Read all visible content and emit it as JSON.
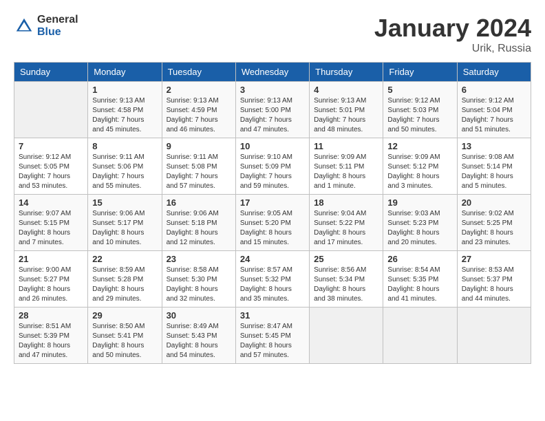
{
  "logo": {
    "general": "General",
    "blue": "Blue"
  },
  "title": {
    "month": "January 2024",
    "location": "Urik, Russia"
  },
  "weekdays": [
    "Sunday",
    "Monday",
    "Tuesday",
    "Wednesday",
    "Thursday",
    "Friday",
    "Saturday"
  ],
  "weeks": [
    [
      {
        "day": "",
        "sunrise": "",
        "sunset": "",
        "daylight": ""
      },
      {
        "day": "1",
        "sunrise": "Sunrise: 9:13 AM",
        "sunset": "Sunset: 4:58 PM",
        "daylight": "Daylight: 7 hours and 45 minutes."
      },
      {
        "day": "2",
        "sunrise": "Sunrise: 9:13 AM",
        "sunset": "Sunset: 4:59 PM",
        "daylight": "Daylight: 7 hours and 46 minutes."
      },
      {
        "day": "3",
        "sunrise": "Sunrise: 9:13 AM",
        "sunset": "Sunset: 5:00 PM",
        "daylight": "Daylight: 7 hours and 47 minutes."
      },
      {
        "day": "4",
        "sunrise": "Sunrise: 9:13 AM",
        "sunset": "Sunset: 5:01 PM",
        "daylight": "Daylight: 7 hours and 48 minutes."
      },
      {
        "day": "5",
        "sunrise": "Sunrise: 9:12 AM",
        "sunset": "Sunset: 5:03 PM",
        "daylight": "Daylight: 7 hours and 50 minutes."
      },
      {
        "day": "6",
        "sunrise": "Sunrise: 9:12 AM",
        "sunset": "Sunset: 5:04 PM",
        "daylight": "Daylight: 7 hours and 51 minutes."
      }
    ],
    [
      {
        "day": "7",
        "sunrise": "Sunrise: 9:12 AM",
        "sunset": "Sunset: 5:05 PM",
        "daylight": "Daylight: 7 hours and 53 minutes."
      },
      {
        "day": "8",
        "sunrise": "Sunrise: 9:11 AM",
        "sunset": "Sunset: 5:06 PM",
        "daylight": "Daylight: 7 hours and 55 minutes."
      },
      {
        "day": "9",
        "sunrise": "Sunrise: 9:11 AM",
        "sunset": "Sunset: 5:08 PM",
        "daylight": "Daylight: 7 hours and 57 minutes."
      },
      {
        "day": "10",
        "sunrise": "Sunrise: 9:10 AM",
        "sunset": "Sunset: 5:09 PM",
        "daylight": "Daylight: 7 hours and 59 minutes."
      },
      {
        "day": "11",
        "sunrise": "Sunrise: 9:09 AM",
        "sunset": "Sunset: 5:11 PM",
        "daylight": "Daylight: 8 hours and 1 minute."
      },
      {
        "day": "12",
        "sunrise": "Sunrise: 9:09 AM",
        "sunset": "Sunset: 5:12 PM",
        "daylight": "Daylight: 8 hours and 3 minutes."
      },
      {
        "day": "13",
        "sunrise": "Sunrise: 9:08 AM",
        "sunset": "Sunset: 5:14 PM",
        "daylight": "Daylight: 8 hours and 5 minutes."
      }
    ],
    [
      {
        "day": "14",
        "sunrise": "Sunrise: 9:07 AM",
        "sunset": "Sunset: 5:15 PM",
        "daylight": "Daylight: 8 hours and 7 minutes."
      },
      {
        "day": "15",
        "sunrise": "Sunrise: 9:06 AM",
        "sunset": "Sunset: 5:17 PM",
        "daylight": "Daylight: 8 hours and 10 minutes."
      },
      {
        "day": "16",
        "sunrise": "Sunrise: 9:06 AM",
        "sunset": "Sunset: 5:18 PM",
        "daylight": "Daylight: 8 hours and 12 minutes."
      },
      {
        "day": "17",
        "sunrise": "Sunrise: 9:05 AM",
        "sunset": "Sunset: 5:20 PM",
        "daylight": "Daylight: 8 hours and 15 minutes."
      },
      {
        "day": "18",
        "sunrise": "Sunrise: 9:04 AM",
        "sunset": "Sunset: 5:22 PM",
        "daylight": "Daylight: 8 hours and 17 minutes."
      },
      {
        "day": "19",
        "sunrise": "Sunrise: 9:03 AM",
        "sunset": "Sunset: 5:23 PM",
        "daylight": "Daylight: 8 hours and 20 minutes."
      },
      {
        "day": "20",
        "sunrise": "Sunrise: 9:02 AM",
        "sunset": "Sunset: 5:25 PM",
        "daylight": "Daylight: 8 hours and 23 minutes."
      }
    ],
    [
      {
        "day": "21",
        "sunrise": "Sunrise: 9:00 AM",
        "sunset": "Sunset: 5:27 PM",
        "daylight": "Daylight: 8 hours and 26 minutes."
      },
      {
        "day": "22",
        "sunrise": "Sunrise: 8:59 AM",
        "sunset": "Sunset: 5:28 PM",
        "daylight": "Daylight: 8 hours and 29 minutes."
      },
      {
        "day": "23",
        "sunrise": "Sunrise: 8:58 AM",
        "sunset": "Sunset: 5:30 PM",
        "daylight": "Daylight: 8 hours and 32 minutes."
      },
      {
        "day": "24",
        "sunrise": "Sunrise: 8:57 AM",
        "sunset": "Sunset: 5:32 PM",
        "daylight": "Daylight: 8 hours and 35 minutes."
      },
      {
        "day": "25",
        "sunrise": "Sunrise: 8:56 AM",
        "sunset": "Sunset: 5:34 PM",
        "daylight": "Daylight: 8 hours and 38 minutes."
      },
      {
        "day": "26",
        "sunrise": "Sunrise: 8:54 AM",
        "sunset": "Sunset: 5:35 PM",
        "daylight": "Daylight: 8 hours and 41 minutes."
      },
      {
        "day": "27",
        "sunrise": "Sunrise: 8:53 AM",
        "sunset": "Sunset: 5:37 PM",
        "daylight": "Daylight: 8 hours and 44 minutes."
      }
    ],
    [
      {
        "day": "28",
        "sunrise": "Sunrise: 8:51 AM",
        "sunset": "Sunset: 5:39 PM",
        "daylight": "Daylight: 8 hours and 47 minutes."
      },
      {
        "day": "29",
        "sunrise": "Sunrise: 8:50 AM",
        "sunset": "Sunset: 5:41 PM",
        "daylight": "Daylight: 8 hours and 50 minutes."
      },
      {
        "day": "30",
        "sunrise": "Sunrise: 8:49 AM",
        "sunset": "Sunset: 5:43 PM",
        "daylight": "Daylight: 8 hours and 54 minutes."
      },
      {
        "day": "31",
        "sunrise": "Sunrise: 8:47 AM",
        "sunset": "Sunset: 5:45 PM",
        "daylight": "Daylight: 8 hours and 57 minutes."
      },
      {
        "day": "",
        "sunrise": "",
        "sunset": "",
        "daylight": ""
      },
      {
        "day": "",
        "sunrise": "",
        "sunset": "",
        "daylight": ""
      },
      {
        "day": "",
        "sunrise": "",
        "sunset": "",
        "daylight": ""
      }
    ]
  ]
}
